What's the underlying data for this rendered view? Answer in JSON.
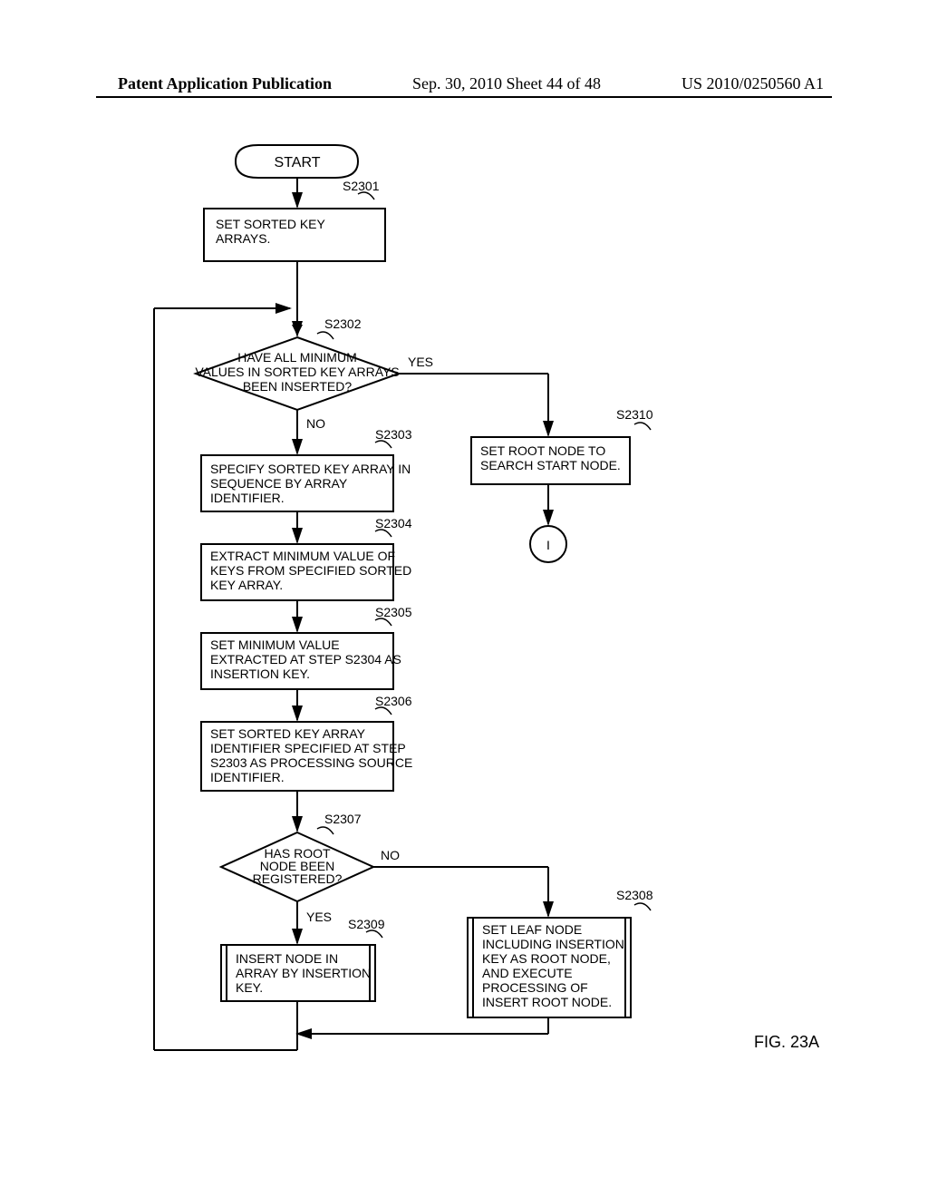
{
  "header": {
    "left": "Patent Application Publication",
    "middle": "Sep. 30, 2010  Sheet 44 of 48",
    "right": "US 2010/0250560 A1"
  },
  "figure_label": "FIG. 23A",
  "start": "START",
  "steps": {
    "s2301": {
      "id": "S2301",
      "text": "SET SORTED KEY ARRAYS."
    },
    "s2302": {
      "id": "S2302",
      "text": "HAVE ALL MINIMUM VALUES IN SORTED KEY ARRAYS BEEN INSERTED?"
    },
    "s2303": {
      "id": "S2303",
      "text": "SPECIFY SORTED KEY ARRAY IN SEQUENCE BY ARRAY IDENTIFIER."
    },
    "s2304": {
      "id": "S2304",
      "text": "EXTRACT MINIMUM VALUE OF KEYS FROM SPECIFIED SORTED KEY ARRAY."
    },
    "s2305": {
      "id": "S2305",
      "text": "SET MINIMUM VALUE EXTRACTED AT STEP S2304 AS INSERTION KEY."
    },
    "s2306": {
      "id": "S2306",
      "text": "SET SORTED KEY ARRAY IDENTIFIER SPECIFIED AT STEP S2303 AS PROCESSING SOURCE IDENTIFIER."
    },
    "s2307": {
      "id": "S2307",
      "text": "HAS ROOT NODE BEEN REGISTERED?"
    },
    "s2308": {
      "id": "S2308",
      "text": "SET LEAF NODE INCLUDING INSERTION KEY AS ROOT NODE, AND EXECUTE PROCESSING OF INSERT ROOT NODE."
    },
    "s2309": {
      "id": "S2309",
      "text": "INSERT NODE IN ARRAY BY INSERTION KEY."
    },
    "s2310": {
      "id": "S2310",
      "text": "SET ROOT NODE TO SEARCH START NODE."
    }
  },
  "labels": {
    "yes": "YES",
    "no": "NO",
    "connector_I": "I"
  }
}
